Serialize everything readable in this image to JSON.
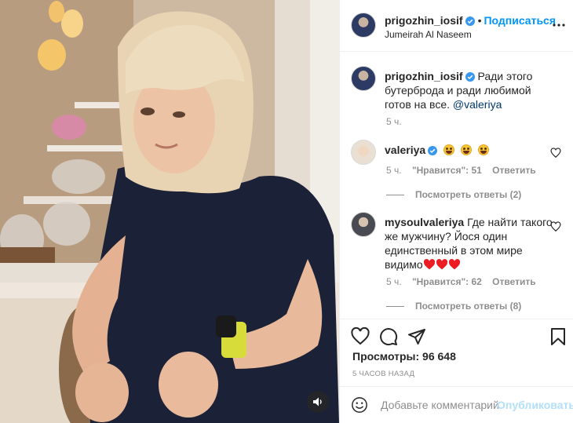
{
  "header": {
    "username": "prigozhin_iosif",
    "separator": "•",
    "follow_label": "Подписаться",
    "location": "Jumeirah Al Naseem"
  },
  "caption": {
    "username": "prigozhin_iosif",
    "text": "Ради этого бутерброда и ради любимой готов на все.",
    "mention": "@valeriya",
    "time": "5 ч."
  },
  "comments": [
    {
      "username": "valeriya",
      "verified": true,
      "text": "",
      "emoji_count": 3,
      "time": "5 ч.",
      "likes": "\"Нравится\": 51",
      "reply_label": "Ответить",
      "view_replies": "Посмотреть ответы (2)"
    },
    {
      "username": "mysoulvaleriya",
      "verified": false,
      "text": "Где найти такого же мужчину? Йося один единственный в этом мире видимо",
      "heart_emoji_count": 3,
      "time": "5 ч.",
      "likes": "\"Нравится\": 62",
      "reply_label": "Ответить",
      "view_replies": "Посмотреть ответы (8)"
    }
  ],
  "actions": {
    "views": "Просмотры: 96 648",
    "timestamp": "5 часов назад"
  },
  "add_comment": {
    "placeholder": "Добавьте комментарий...",
    "publish_label": "Опубликовать"
  },
  "colors": {
    "link_blue": "#0095f6",
    "verified_blue": "#3897f0",
    "muted": "#8e8e8e",
    "heart_red": "#ed4956",
    "publish_disabled": "#b2dffc"
  },
  "icons": [
    "verified-badge-icon",
    "more-options-icon",
    "like-heart-icon",
    "comment-bubble-icon",
    "share-paper-plane-icon",
    "save-bookmark-icon",
    "emoji-smiley-icon",
    "sound-on-icon"
  ]
}
